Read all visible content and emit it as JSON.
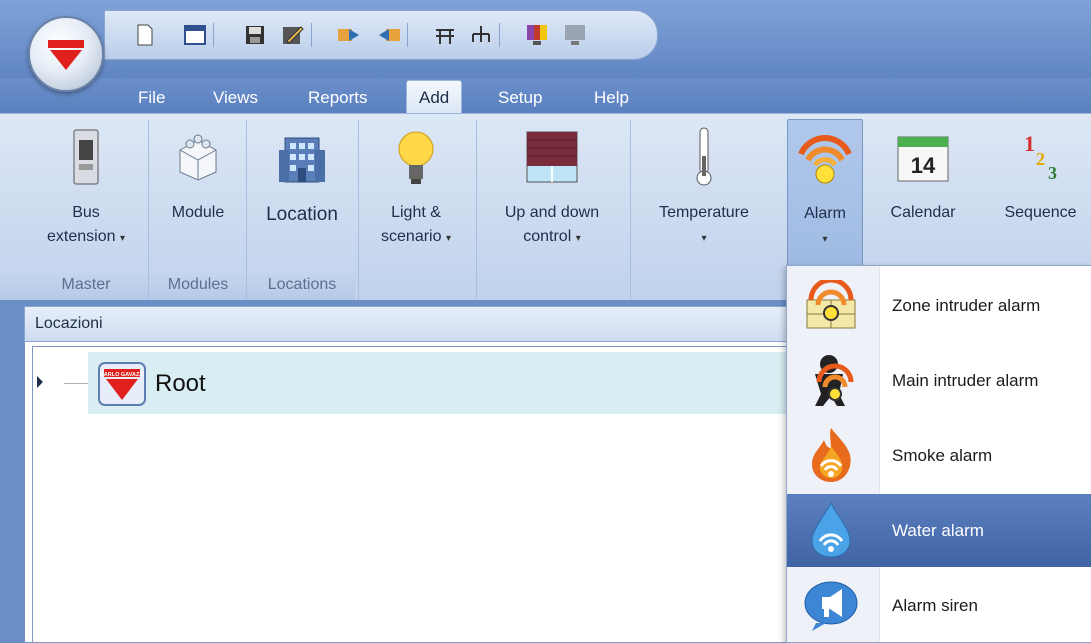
{
  "quick_access": {
    "icons": [
      "new-document-icon",
      "open-window-icon",
      "save-icon",
      "edit-icon",
      "export-icon",
      "import-icon",
      "network-icon",
      "topology-icon",
      "color-monitor-icon",
      "monitor-icon"
    ]
  },
  "menu": {
    "tabs": [
      {
        "label": "File"
      },
      {
        "label": "Views"
      },
      {
        "label": "Reports"
      },
      {
        "label": "Add",
        "active": true
      },
      {
        "label": "Setup"
      },
      {
        "label": "Help"
      }
    ]
  },
  "ribbon": {
    "buttons": [
      {
        "line1": "Bus",
        "line2": "extension"
      },
      {
        "line1": "Module"
      },
      {
        "line1": "Location"
      },
      {
        "line1": "Light &",
        "line2": "scenario"
      },
      {
        "line1": "Up and down",
        "line2": "control"
      },
      {
        "line1": "Temperature"
      },
      {
        "line1": "Alarm"
      },
      {
        "line1": "Calendar"
      },
      {
        "line1": "Sequence"
      }
    ],
    "groups": [
      "Master",
      "Modules",
      "Locations"
    ],
    "calendar_day": "14",
    "sequence_digits": [
      "1",
      "2",
      "3"
    ]
  },
  "panel": {
    "title": "Locazioni",
    "root_label": "Root",
    "root_icon_text": "CARLO GAVAZZI"
  },
  "alarm_menu": {
    "items": [
      {
        "label": "Zone intruder alarm",
        "icon": "zone-intruder-alarm-icon"
      },
      {
        "label": "Main intruder alarm",
        "icon": "main-intruder-alarm-icon"
      },
      {
        "label": "Smoke alarm",
        "icon": "smoke-alarm-icon"
      },
      {
        "label": "Water alarm",
        "icon": "water-alarm-icon",
        "highlighted": true
      },
      {
        "label": "Alarm siren",
        "icon": "alarm-siren-icon"
      }
    ]
  },
  "colors": {
    "brand_red": "#e0201c",
    "ribbon_light": "#dde8f6",
    "highlight_blue": "#4a6eae"
  }
}
